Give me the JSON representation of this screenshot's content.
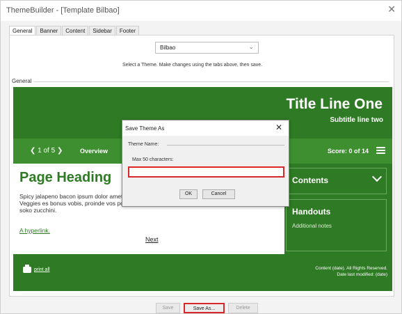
{
  "window": {
    "title": "ThemeBuilder - [Template Bilbao]",
    "close_glyph": "✕"
  },
  "tabs": [
    {
      "label": "General"
    },
    {
      "label": "Banner"
    },
    {
      "label": "Content"
    },
    {
      "label": "Sidebar"
    },
    {
      "label": "Footer"
    }
  ],
  "theme_select": {
    "value": "Bilbao",
    "chevron": "⌄"
  },
  "hint": "Select a Theme. Make changes using the tabs above, then save.",
  "group_label": "General",
  "preview": {
    "colors": {
      "banner": "#2f7a24",
      "navbar": "#3d8f30",
      "heading": "#2f7a24"
    },
    "banner": {
      "title": "Title Line One",
      "subtitle": "Subtitle line two"
    },
    "navbar": {
      "pager": "❮ 1 of 5 ❯",
      "overview": "Overview",
      "score": "Score: 0 of 14"
    },
    "content": {
      "heading": "Page Heading",
      "body": "Spicy jalapeno bacon ipsum dolor amet biltong boudin. Cupim spare ribs et reprehenderit biltong. Veggies es bonus vobis, proinde vos postulo essum dandelion cucumber earthnut pea peanut soko zucchini.",
      "link": "A hyperlink.",
      "next": "Next"
    },
    "sidebar": {
      "contents_label": "Contents",
      "handouts_label": "Handouts",
      "handouts_notes": "Additional notes"
    },
    "footer": {
      "print_label": "print all",
      "rights": "Content (date). All Rights Reserved.",
      "modified": "Date last modified: (date)"
    }
  },
  "dialog": {
    "title": "Save Theme As",
    "close_glyph": "✕",
    "fieldset_label": "Theme Name:",
    "max_label": "Max 50 characters:",
    "input_value": "",
    "ok_label": "OK",
    "cancel_label": "Cancel"
  },
  "bottom": {
    "save_label": "Save",
    "save_as_label": "Save As...",
    "delete_label": "Delete"
  },
  "accent": {
    "highlight": "#d9262a"
  }
}
